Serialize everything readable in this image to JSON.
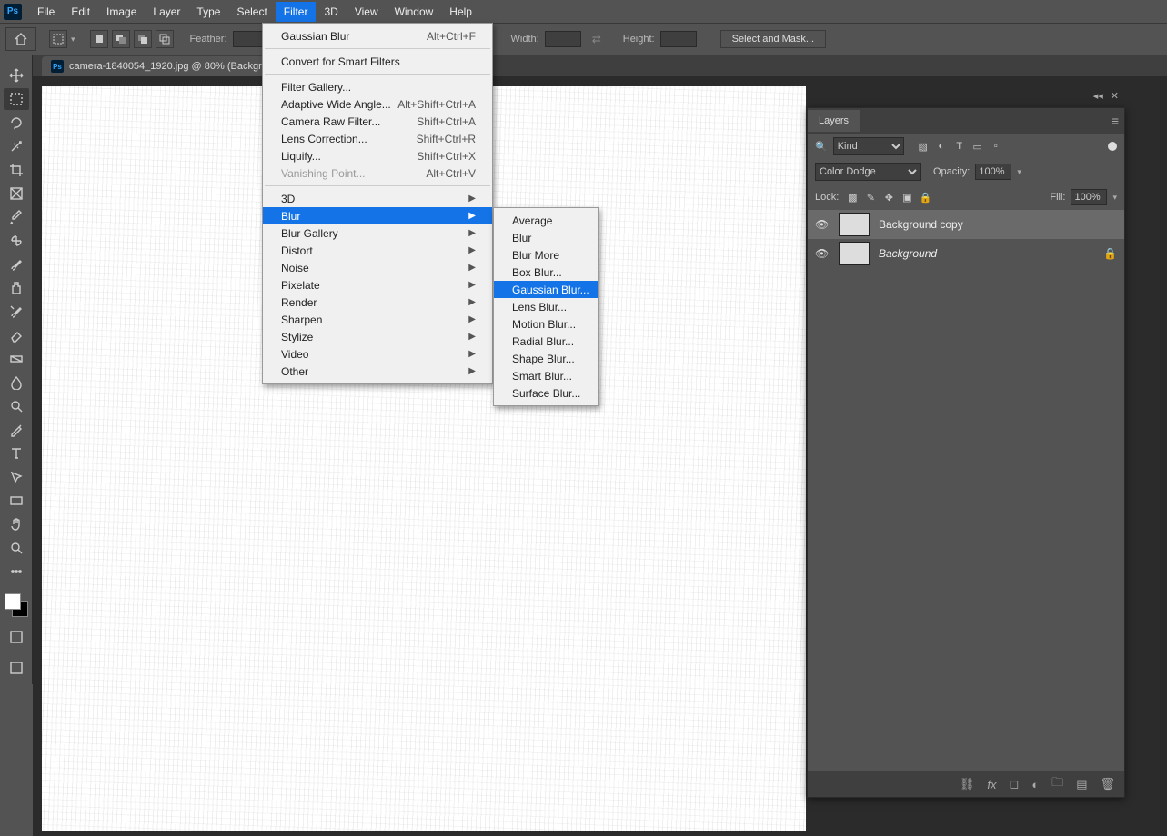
{
  "menubar": [
    "File",
    "Edit",
    "Image",
    "Layer",
    "Type",
    "Select",
    "Filter",
    "3D",
    "View",
    "Window",
    "Help"
  ],
  "menubar_active_index": 6,
  "optbar": {
    "feather_label": "Feather:",
    "width_label": "Width:",
    "height_label": "Height:",
    "select_mask": "Select and Mask..."
  },
  "doc_tab": "camera-1840054_1920.jpg @ 80% (Backgr",
  "filter_menu": {
    "top": [
      {
        "label": "Gaussian Blur",
        "shortcut": "Alt+Ctrl+F"
      }
    ],
    "mid1": [
      {
        "label": "Convert for Smart Filters"
      }
    ],
    "mid2": [
      {
        "label": "Filter Gallery..."
      },
      {
        "label": "Adaptive Wide Angle...",
        "shortcut": "Alt+Shift+Ctrl+A"
      },
      {
        "label": "Camera Raw Filter...",
        "shortcut": "Shift+Ctrl+A"
      },
      {
        "label": "Lens Correction...",
        "shortcut": "Shift+Ctrl+R"
      },
      {
        "label": "Liquify...",
        "shortcut": "Shift+Ctrl+X"
      },
      {
        "label": "Vanishing Point...",
        "shortcut": "Alt+Ctrl+V",
        "disabled": true
      }
    ],
    "sub": [
      {
        "label": "3D",
        "arrow": true
      },
      {
        "label": "Blur",
        "arrow": true,
        "hl": true
      },
      {
        "label": "Blur Gallery",
        "arrow": true
      },
      {
        "label": "Distort",
        "arrow": true
      },
      {
        "label": "Noise",
        "arrow": true
      },
      {
        "label": "Pixelate",
        "arrow": true
      },
      {
        "label": "Render",
        "arrow": true
      },
      {
        "label": "Sharpen",
        "arrow": true
      },
      {
        "label": "Stylize",
        "arrow": true
      },
      {
        "label": "Video",
        "arrow": true
      },
      {
        "label": "Other",
        "arrow": true
      }
    ]
  },
  "blur_submenu": [
    {
      "label": "Average"
    },
    {
      "label": "Blur"
    },
    {
      "label": "Blur More"
    },
    {
      "label": "Box Blur..."
    },
    {
      "label": "Gaussian Blur...",
      "hl": true
    },
    {
      "label": "Lens Blur..."
    },
    {
      "label": "Motion Blur..."
    },
    {
      "label": "Radial Blur..."
    },
    {
      "label": "Shape Blur..."
    },
    {
      "label": "Smart Blur..."
    },
    {
      "label": "Surface Blur..."
    }
  ],
  "layers": {
    "tab": "Layers",
    "kind_label": "Kind",
    "blend_mode": "Color Dodge",
    "opacity_label": "Opacity:",
    "opacity_value": "100%",
    "lock_label": "Lock:",
    "fill_label": "Fill:",
    "fill_value": "100%",
    "items": [
      {
        "name": "Background copy",
        "locked": false,
        "selected": true
      },
      {
        "name": "Background",
        "locked": true,
        "italic": true
      }
    ]
  },
  "tools": [
    "move",
    "marquee",
    "lasso",
    "wand",
    "crop",
    "frame",
    "eyedropper",
    "healing",
    "brush",
    "clone",
    "history-brush",
    "eraser",
    "gradient",
    "blur",
    "dodge",
    "pen",
    "type",
    "path-select",
    "rectangle",
    "hand",
    "zoom",
    "more"
  ]
}
